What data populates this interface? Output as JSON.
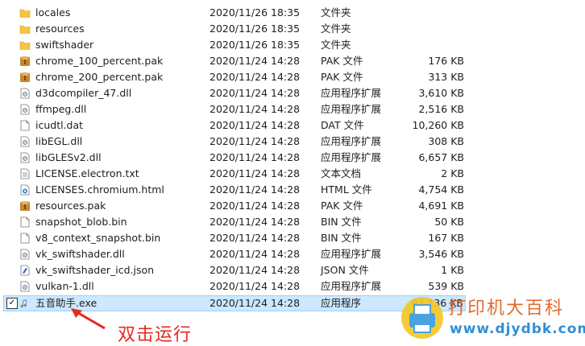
{
  "files": [
    {
      "name": "locales",
      "date": "2020/11/26 18:35",
      "type": "文件夹",
      "size": "",
      "icon": "folder-icon"
    },
    {
      "name": "resources",
      "date": "2020/11/26 18:35",
      "type": "文件夹",
      "size": "",
      "icon": "folder-icon"
    },
    {
      "name": "swiftshader",
      "date": "2020/11/26 18:35",
      "type": "文件夹",
      "size": "",
      "icon": "folder-icon"
    },
    {
      "name": "chrome_100_percent.pak",
      "date": "2020/11/24 14:28",
      "type": "PAK 文件",
      "size": "176 KB",
      "icon": "pak-file-icon"
    },
    {
      "name": "chrome_200_percent.pak",
      "date": "2020/11/24 14:28",
      "type": "PAK 文件",
      "size": "313 KB",
      "icon": "pak-file-icon"
    },
    {
      "name": "d3dcompiler_47.dll",
      "date": "2020/11/24 14:28",
      "type": "应用程序扩展",
      "size": "3,610 KB",
      "icon": "dll-file-icon"
    },
    {
      "name": "ffmpeg.dll",
      "date": "2020/11/24 14:28",
      "type": "应用程序扩展",
      "size": "2,516 KB",
      "icon": "dll-file-icon"
    },
    {
      "name": "icudtl.dat",
      "date": "2020/11/24 14:28",
      "type": "DAT 文件",
      "size": "10,260 KB",
      "icon": "blank-file-icon"
    },
    {
      "name": "libEGL.dll",
      "date": "2020/11/24 14:28",
      "type": "应用程序扩展",
      "size": "308 KB",
      "icon": "dll-file-icon"
    },
    {
      "name": "libGLESv2.dll",
      "date": "2020/11/24 14:28",
      "type": "应用程序扩展",
      "size": "6,657 KB",
      "icon": "dll-file-icon"
    },
    {
      "name": "LICENSE.electron.txt",
      "date": "2020/11/24 14:28",
      "type": "文本文档",
      "size": "2 KB",
      "icon": "text-file-icon"
    },
    {
      "name": "LICENSES.chromium.html",
      "date": "2020/11/24 14:28",
      "type": "HTML 文件",
      "size": "4,754 KB",
      "icon": "html-file-icon"
    },
    {
      "name": "resources.pak",
      "date": "2020/11/24 14:28",
      "type": "PAK 文件",
      "size": "4,691 KB",
      "icon": "pak-file-icon"
    },
    {
      "name": "snapshot_blob.bin",
      "date": "2020/11/24 14:28",
      "type": "BIN 文件",
      "size": "50 KB",
      "icon": "blank-file-icon"
    },
    {
      "name": "v8_context_snapshot.bin",
      "date": "2020/11/24 14:28",
      "type": "BIN 文件",
      "size": "167 KB",
      "icon": "blank-file-icon"
    },
    {
      "name": "vk_swiftshader.dll",
      "date": "2020/11/24 14:28",
      "type": "应用程序扩展",
      "size": "3,546 KB",
      "icon": "dll-file-icon"
    },
    {
      "name": "vk_swiftshader_icd.json",
      "date": "2020/11/24 14:28",
      "type": "JSON 文件",
      "size": "1 KB",
      "icon": "json-file-icon"
    },
    {
      "name": "vulkan-1.dll",
      "date": "2020/11/24 14:28",
      "type": "应用程序扩展",
      "size": "539 KB",
      "icon": "dll-file-icon"
    }
  ],
  "selected_file": {
    "name": "五音助手.exe",
    "date": "2020/11/24 14:28",
    "type": "应用程序",
    "size": "93,136 KB",
    "icon": "music-app-icon",
    "checked": true
  },
  "annotation_text": "双击运行",
  "watermark": {
    "top": "打印机大百科",
    "bottom": "www.djydbk.com"
  },
  "colors": {
    "annotation": "#e8281e",
    "selection_bg": "#cde8ff",
    "selection_border": "#99d1ff",
    "folder": "#f4c542"
  }
}
